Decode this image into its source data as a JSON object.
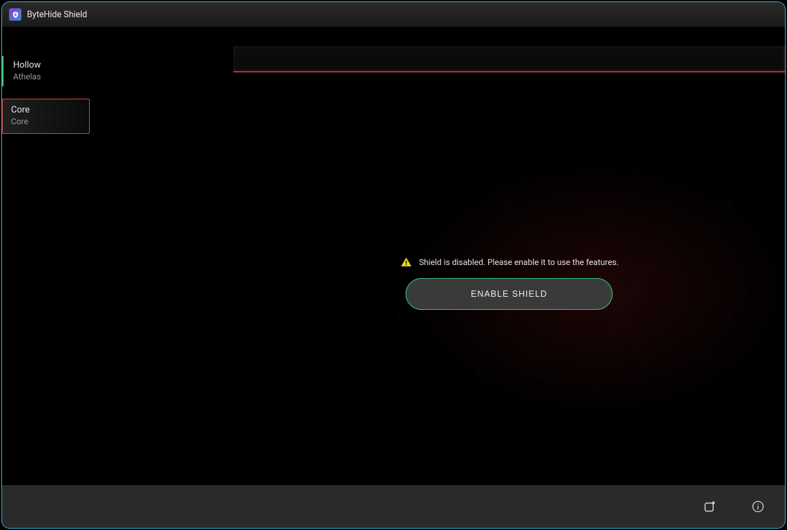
{
  "titlebar": {
    "title": "ByteHide Shield"
  },
  "sidebar": {
    "items": [
      {
        "name": "Hollow",
        "subtitle": "Athelas",
        "selected": false
      },
      {
        "name": "Core",
        "subtitle": "Core",
        "selected": true
      }
    ]
  },
  "main": {
    "warning_text": "Shield is disabled. Please enable it to use the features.",
    "enable_button_label": "ENABLE SHIELD"
  },
  "footer": {
    "icons": [
      "open-external-icon",
      "info-icon"
    ]
  },
  "colors": {
    "window_border": "#3bb4d6",
    "accent_green": "#3ac27c",
    "danger_border": "#d9463a",
    "topbar_underline": "#b42d3f",
    "warning_yellow": "#f2d51a"
  }
}
